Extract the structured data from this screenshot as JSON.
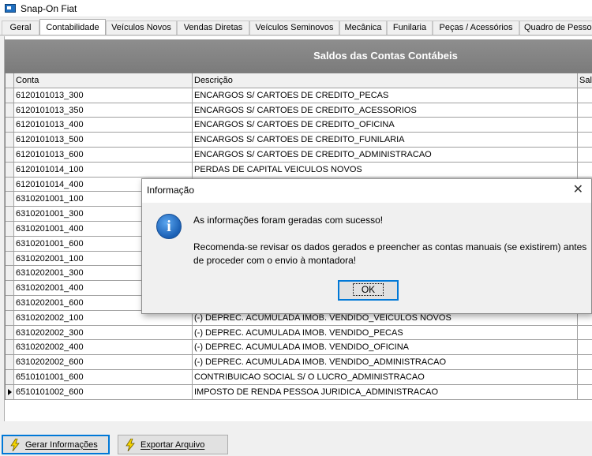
{
  "window": {
    "title": "Snap-On Fiat"
  },
  "tabs": [
    {
      "label": "Geral"
    },
    {
      "label": "Contabilidade"
    },
    {
      "label": "Veículos Novos"
    },
    {
      "label": "Vendas Diretas"
    },
    {
      "label": "Veículos Seminovos"
    },
    {
      "label": "Mecânica"
    },
    {
      "label": "Funilaria"
    },
    {
      "label": "Peças / Acessórios"
    },
    {
      "label": "Quadro de Pessoal"
    }
  ],
  "active_tab": "Contabilidade",
  "grid": {
    "title": "Saldos das Contas Contábeis",
    "columns": [
      "Conta",
      "Descrição",
      "Saldo"
    ],
    "rows": [
      {
        "conta": "6120101013_300",
        "descricao": "ENCARGOS S/ CARTOES DE CREDITO_PECAS"
      },
      {
        "conta": "6120101013_350",
        "descricao": "ENCARGOS S/ CARTOES DE CREDITO_ACESSORIOS"
      },
      {
        "conta": "6120101013_400",
        "descricao": "ENCARGOS S/ CARTOES DE CREDITO_OFICINA"
      },
      {
        "conta": "6120101013_500",
        "descricao": "ENCARGOS S/ CARTOES DE CREDITO_FUNILARIA"
      },
      {
        "conta": "6120101013_600",
        "descricao": "ENCARGOS S/ CARTOES DE CREDITO_ADMINISTRACAO"
      },
      {
        "conta": "6120101014_100",
        "descricao": "PERDAS DE CAPITAL  VEICULOS NOVOS"
      },
      {
        "conta": "6120101014_400",
        "descricao": ""
      },
      {
        "conta": "6310201001_100",
        "descricao": ""
      },
      {
        "conta": "6310201001_300",
        "descricao": ""
      },
      {
        "conta": "6310201001_400",
        "descricao": ""
      },
      {
        "conta": "6310201001_600",
        "descricao": ""
      },
      {
        "conta": "6310202001_100",
        "descricao": ""
      },
      {
        "conta": "6310202001_300",
        "descricao": ""
      },
      {
        "conta": "6310202001_400",
        "descricao": ""
      },
      {
        "conta": "6310202001_600",
        "descricao": ""
      },
      {
        "conta": "6310202002_100",
        "descricao": "(-) DEPREC. ACUMULADA IMOB. VENDIDO_VEICULOS NOVOS"
      },
      {
        "conta": "6310202002_300",
        "descricao": "(-) DEPREC. ACUMULADA IMOB. VENDIDO_PECAS"
      },
      {
        "conta": "6310202002_400",
        "descricao": "(-) DEPREC. ACUMULADA IMOB. VENDIDO_OFICINA"
      },
      {
        "conta": "6310202002_600",
        "descricao": "(-) DEPREC. ACUMULADA IMOB. VENDIDO_ADMINISTRACAO"
      },
      {
        "conta": "6510101001_600",
        "descricao": "CONTRIBUICAO SOCIAL S/ O LUCRO_ADMINISTRACAO"
      },
      {
        "conta": "6510101002_600",
        "descricao": "IMPOSTO DE RENDA PESSOA JURIDICA_ADMINISTRACAO"
      }
    ]
  },
  "buttons": {
    "gerar": "Gerar Informações",
    "exportar": "Exportar Arquivo"
  },
  "dialog": {
    "title": "Informação",
    "close": "✕",
    "message1": "As informações foram geradas com sucesso!",
    "message2": "Recomenda-se revisar os dados gerados e preencher as contas manuais (se existirem) antes de proceder com o envio à montadora!",
    "ok": "OK",
    "icon": "info-icon"
  },
  "colors": {
    "header_bg": "#808080",
    "focus_border": "#0078d7",
    "bolt_yellow": "#f5d400",
    "info_blue": "#1a5fb4"
  }
}
